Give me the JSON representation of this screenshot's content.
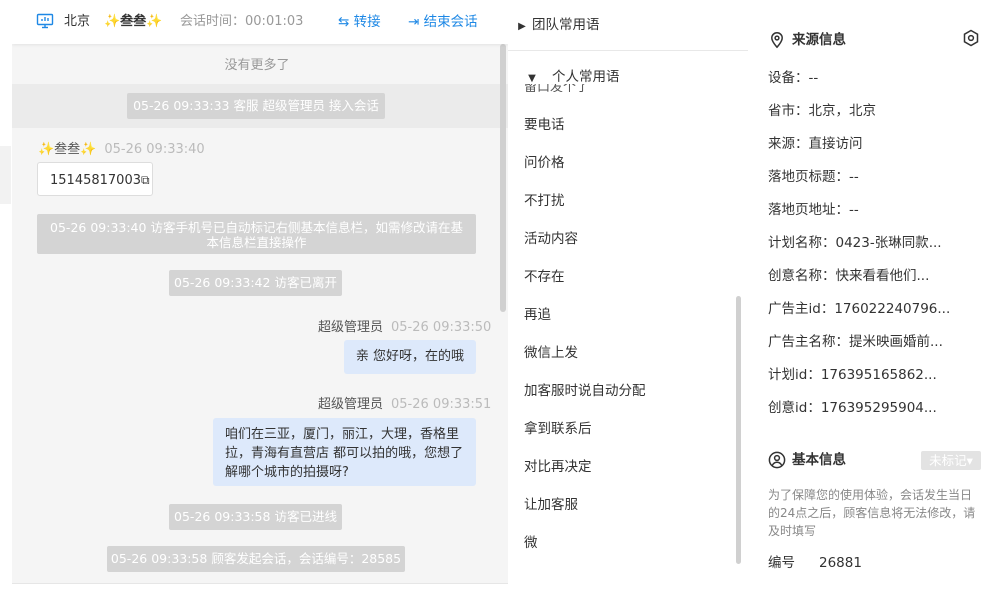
{
  "header": {
    "location": "北京",
    "visitor_name": "✨叁叁✨",
    "session_time_label": "会话时间：",
    "session_time": "00:01:03",
    "transfer_label": "转接",
    "end_label": "结束会话"
  },
  "chat": {
    "no_more": "没有更多了",
    "sys_join": "05-26 09:33:33 客服 超级管理员 接入会话",
    "visitor_sender": "✨叁叁✨",
    "visitor_time": "05-26 09:33:40",
    "visitor_message": "15145817003",
    "sys_auto_mark": "05-26 09:33:40 访客手机号已自动标记右侧基本信息栏，如需修改请在基本信息栏直接操作",
    "sys_leave": "05-26 09:33:42 访客已离开",
    "agent_sender_1": "超级管理员",
    "agent_time_1": "05-26 09:33:50",
    "agent_message_1": "亲 您好呀，在的哦",
    "agent_sender_2": "超级管理员",
    "agent_time_2": "05-26 09:33:51",
    "agent_message_2": "咱们在三亚，厦门，丽江，大理，香格里拉，青海有直营店 都可以拍的哦，您想了解哪个城市的拍摄呀?",
    "sys_enter": "05-26 09:33:58 访客已进线",
    "sys_start": "05-26 09:33:58 顾客发起会话，会话编号：28585"
  },
  "phrases": {
    "team_label": "团队常用语",
    "personal_label": "个人常用语",
    "clipped_item": "留口发个了",
    "items": [
      "要电话",
      "问价格",
      "不打扰",
      "活动内容",
      "不存在",
      "再追",
      "微信上发",
      "加客服时说自动分配",
      "拿到联系后",
      "对比再决定",
      "让加客服",
      "微"
    ]
  },
  "source_info": {
    "title": "来源信息",
    "rows": [
      "设备：--",
      "省市：北京，北京",
      "来源：直接访问",
      "落地页标题：--",
      "落地页地址：--",
      "计划名称：0423-张琳同款...",
      "创意名称：快来看看他们...",
      "广告主id：176022240796...",
      "广告主名称：提米映画婚前...",
      "计划id：176395165862...",
      "创意id：176395295904..."
    ]
  },
  "basic_info": {
    "title": "基本信息",
    "tag_button": "未标记▾",
    "hint": "为了保障您的使用体验，会话发生当日的24点之后，顾客信息将无法修改，请及时填写",
    "number_label": "编号",
    "number_value": "26881"
  },
  "colors": {
    "link": "#1e88e5",
    "bubble_agent": "#dde9fb",
    "system_msg": "#d4d4d4"
  }
}
